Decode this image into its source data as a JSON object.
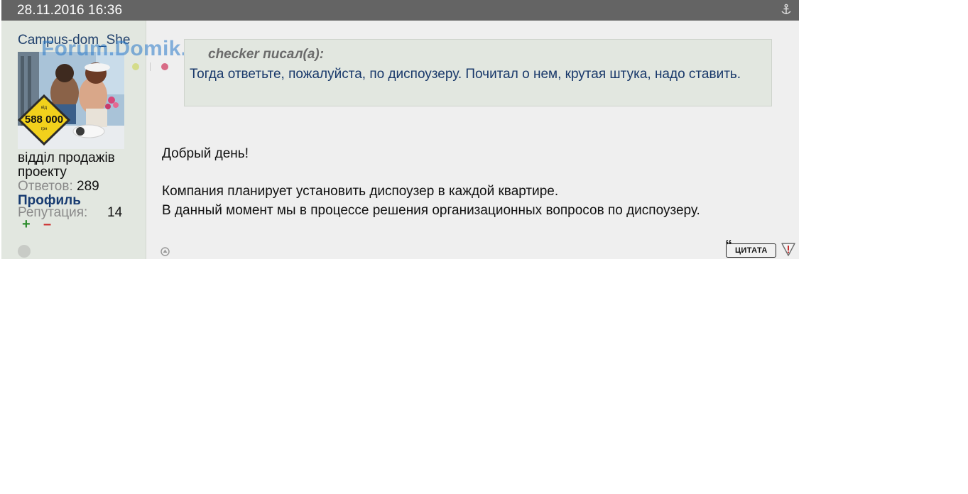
{
  "post": {
    "date": "28.11.2016 16:36",
    "author": {
      "username": "Campus-dom_She",
      "title": "відділ продажів проекту",
      "answers_label": "Ответов:",
      "answers_value": "289",
      "profile_label": "Профиль",
      "reputation_label": "Репутация:",
      "reputation_value": "14",
      "rep_plus": "+",
      "rep_minus": "–",
      "avatar_price": "588 000",
      "avatar_small_top": "від",
      "avatar_small_bottom": "грн"
    },
    "watermark": "Forum.Domik.ua",
    "quote": {
      "author": "checker писал(а):",
      "text": "Тогда ответьте, пожалуйста, по диспоузеру. Почитал о нем, крутая штука, надо ставить."
    },
    "body": {
      "line1": "Добрый день!",
      "line2": "Компания планирует установить диспоузер в каждой квартире.",
      "line3": "В данный момент мы в процессе решения организационных вопросов по диспоузеру."
    },
    "actions": {
      "quote_button": "ЦИТАТА",
      "quote_mark": "“"
    }
  },
  "icons": {
    "header": "anchor-icon",
    "top": "up-arrow-icon",
    "report": "warning-icon",
    "status": "offline-status-icon"
  },
  "colors": {
    "header_bg": "#646464",
    "sidebar_bg": "#e2e7e0",
    "content_bg": "#efefef",
    "link": "#163a70",
    "plus": "#2c8c2c",
    "minus": "#cc2b2b"
  }
}
